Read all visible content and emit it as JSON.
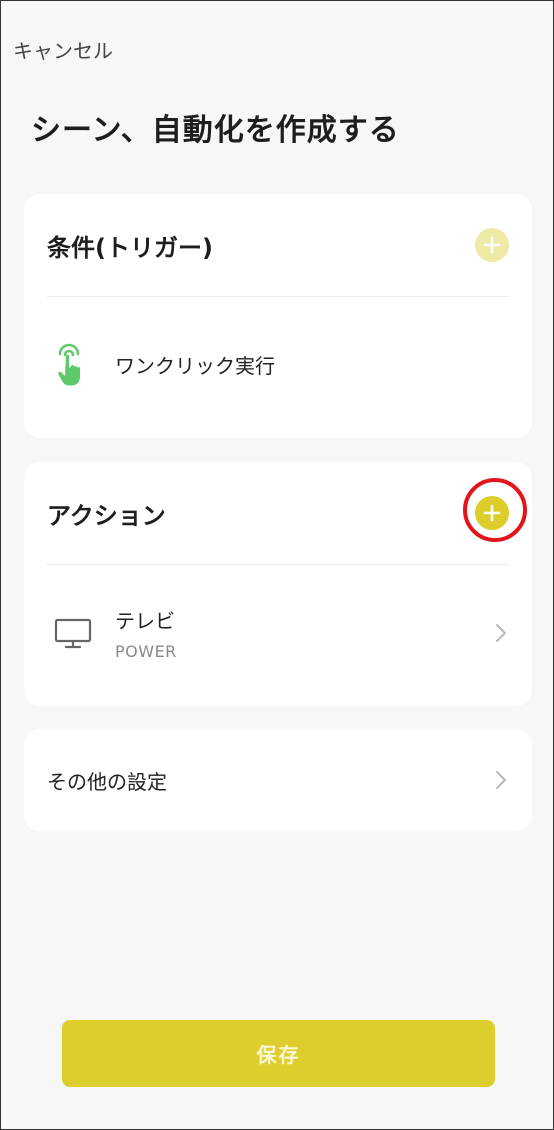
{
  "header": {
    "cancel_label": "キャンセル",
    "title": "シーン、自動化を作成する"
  },
  "trigger_card": {
    "title": "条件(トリガー)",
    "add_button_color": "#efe9a6",
    "item": {
      "icon": "tap-hand-icon",
      "label": "ワンクリック実行",
      "icon_color": "#5dc96b"
    }
  },
  "action_card": {
    "title": "アクション",
    "add_button_color": "#dccd2b",
    "highlight_color": "#e3141c",
    "item": {
      "icon": "tv-icon",
      "title": "テレビ",
      "subtitle": "POWER"
    }
  },
  "other_card": {
    "label": "その他の設定"
  },
  "footer": {
    "save_label": "保存",
    "save_color": "#ddcd2d"
  }
}
